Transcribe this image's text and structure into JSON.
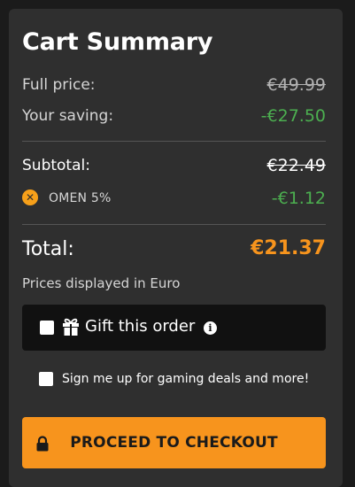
{
  "summary": {
    "title": "Cart Summary",
    "full_price_label": "Full price:",
    "full_price_value": "€49.99",
    "saving_label": "Your saving:",
    "saving_value": "-€27.50",
    "subtotal_label": "Subtotal:",
    "subtotal_value": "€22.49",
    "coupon_label": "OMEN 5%",
    "coupon_value": "-€1.12",
    "total_label": "Total:",
    "total_value": "€21.37",
    "currency_note": "Prices displayed in Euro"
  },
  "gift": {
    "label": "Gift this order",
    "checked": false,
    "info_glyph": "i"
  },
  "signup": {
    "label": "Sign me up for gaming deals and more!",
    "checked": false
  },
  "checkout": {
    "label": "PROCEED TO CHECKOUT"
  },
  "icons": {
    "coupon_remove": "remove-coupon-icon",
    "gift": "gift-icon",
    "info": "info-icon",
    "lock": "lock-icon"
  },
  "colors": {
    "accent": "#f7941d",
    "saving": "#4caf50",
    "panel": "#2f2f2f",
    "gift_box": "#111111"
  }
}
